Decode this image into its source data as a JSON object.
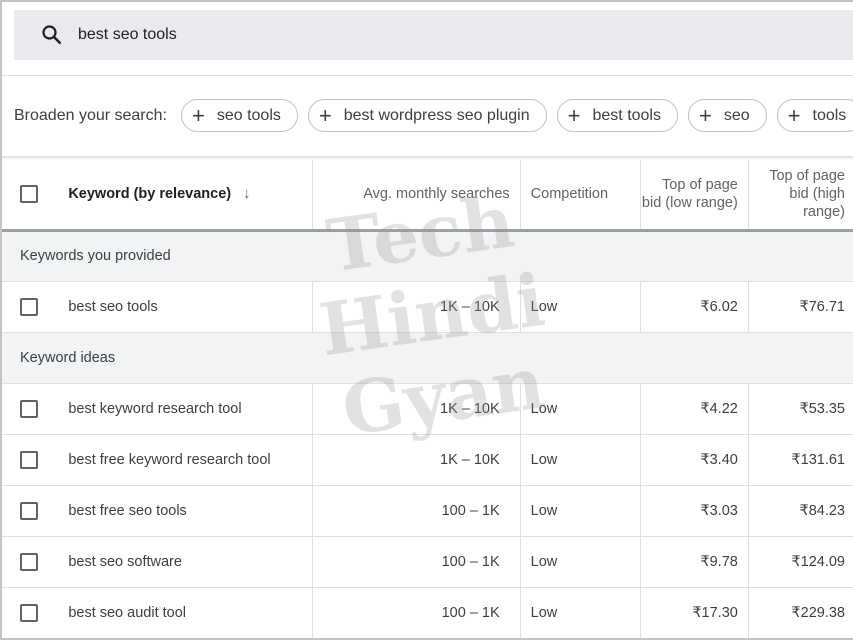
{
  "search": {
    "icon": "search-icon",
    "query": "best seo tools"
  },
  "broaden": {
    "label": "Broaden your search:",
    "chips": [
      "seo tools",
      "best wordpress seo plugin",
      "best tools",
      "seo",
      "tools"
    ]
  },
  "table": {
    "headers": {
      "keyword": "Keyword (by relevance)",
      "sort_icon": "arrow-down-icon",
      "avg": "Avg. monthly searches",
      "competition": "Competition",
      "low": "Top of page bid (low range)",
      "high": "Top of page bid (high range)"
    },
    "sections": [
      {
        "title": "Keywords you provided",
        "rows": [
          {
            "keyword": "best seo tools",
            "avg": "1K – 10K",
            "competition": "Low",
            "low": "₹6.02",
            "high": "₹76.71"
          }
        ]
      },
      {
        "title": "Keyword ideas",
        "rows": [
          {
            "keyword": "best keyword research tool",
            "avg": "1K – 10K",
            "competition": "Low",
            "low": "₹4.22",
            "high": "₹53.35"
          },
          {
            "keyword": "best free keyword research tool",
            "avg": "1K – 10K",
            "competition": "Low",
            "low": "₹3.40",
            "high": "₹131.61"
          },
          {
            "keyword": "best free seo tools",
            "avg": "100 – 1K",
            "competition": "Low",
            "low": "₹3.03",
            "high": "₹84.23"
          },
          {
            "keyword": "best seo software",
            "avg": "100 – 1K",
            "competition": "Low",
            "low": "₹9.78",
            "high": "₹124.09"
          },
          {
            "keyword": "best seo audit tool",
            "avg": "100 – 1K",
            "competition": "Low",
            "low": "₹17.30",
            "high": "₹229.38"
          }
        ]
      }
    ]
  },
  "watermark": "Tech Hindi Gyan"
}
